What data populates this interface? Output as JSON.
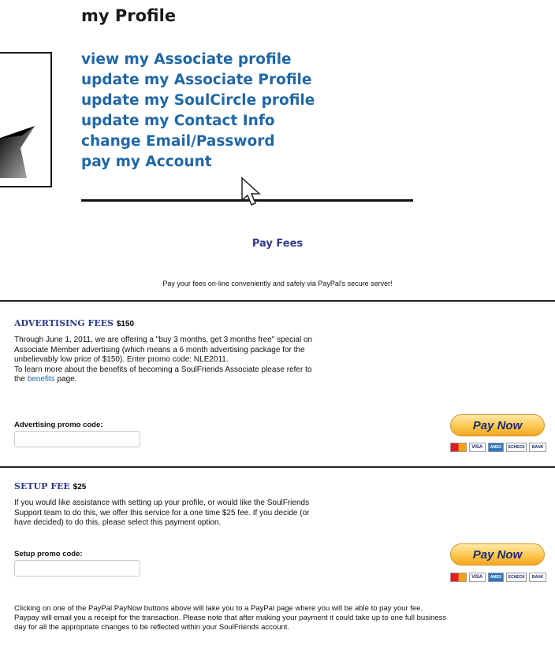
{
  "profile": {
    "title": "my Profile",
    "links": [
      "view my Associate profile",
      "update my Associate Profile",
      "update my SoulCircle profile",
      "update my Contact Info",
      "change Email/Password",
      "pay my Account"
    ]
  },
  "pay_fees": {
    "title": "Pay Fees",
    "intro": "Pay your fees on-line conveniently and safely via PayPal's secure server!"
  },
  "advertising": {
    "title": "ADVERTISING FEES",
    "price": "$150",
    "para_lines": [
      "Through June 1, 2011, we are offering a \"buy 3 months, get 3 months free\" special on",
      "Associate Member advertising (which means a 6 month advertising package for the",
      "unbelievably low price of $150). Enter promo code: NLE2011.",
      "To learn more about the benefits of becoming a SoulFriends Associate please refer to"
    ],
    "para_last_prefix": "the ",
    "benefits_link": "benefits",
    "para_last_suffix": " page.",
    "promo_label": "Advertising promo code:",
    "promo_value": ""
  },
  "setup": {
    "title": "SETUP FEE",
    "price": "$25",
    "para_lines": [
      "If you would like assistance with setting up your profile, or would like the SoulFriends",
      "Support team to do this, we offer this service for a one time $25 fee. If you decide (or",
      "have decided) to do this, please select this payment option."
    ],
    "promo_label": "Setup promo code:",
    "promo_value": ""
  },
  "paynow_label": "Pay Now",
  "card_labels": [
    "MasterCard",
    "VISA",
    "AMEX",
    "ECHECK",
    "BANK"
  ],
  "footer_lines": [
    "Clicking on one of the PayPal PayNow buttons above will take you to a PayPal page where you will be able to pay your fee.",
    "Paypay will email you a receipt for the transaction. Please note that after making your payment it could take up to one full business",
    "day for all the appropriate changes to be reflected within your SoulFriends account."
  ],
  "colors": {
    "link": "#2167a6",
    "heading_blue": "#2d3a8c",
    "paynow_gold": "#fbc74f"
  }
}
